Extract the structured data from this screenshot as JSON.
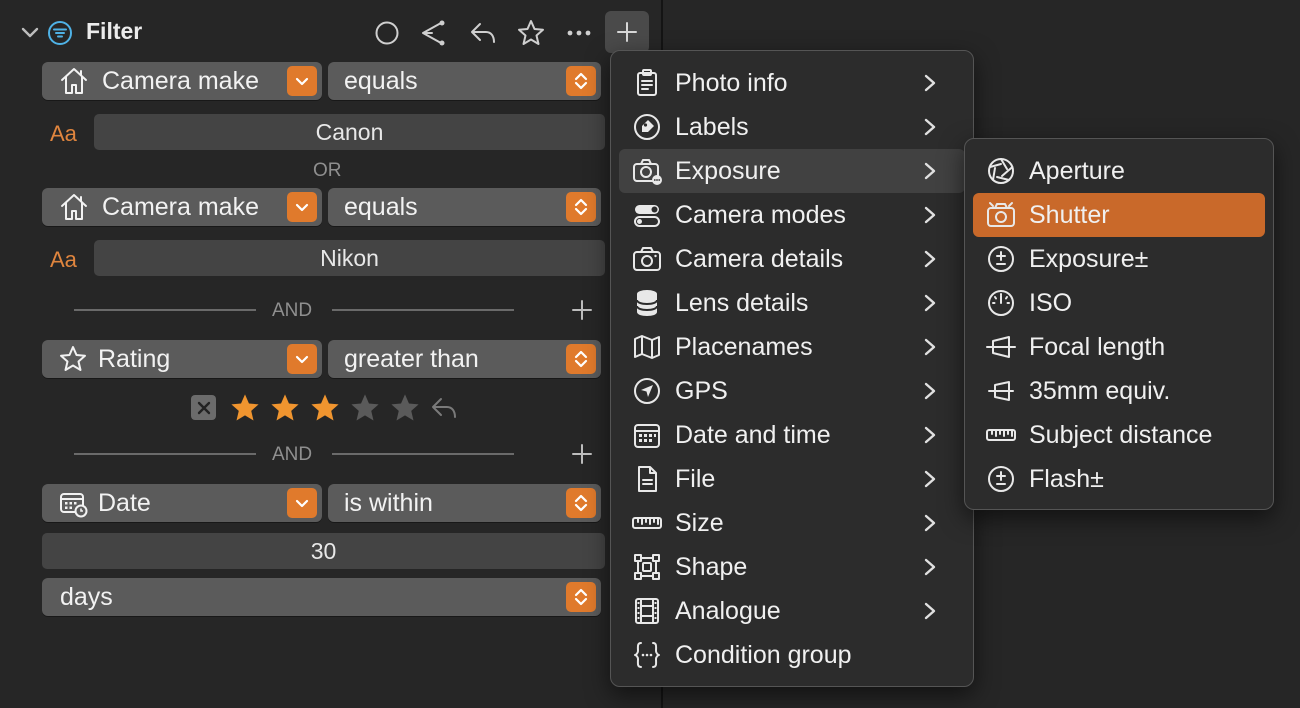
{
  "header": {
    "title": "Filter"
  },
  "conditions": {
    "row1": {
      "field": "Camera make",
      "operator": "equals",
      "value": "Canon",
      "text_type_label": "Aa"
    },
    "or_label": "OR",
    "row2": {
      "field": "Camera make",
      "operator": "equals",
      "value": "Nikon",
      "text_type_label": "Aa"
    },
    "and_label_1": "AND",
    "row3": {
      "field": "Rating",
      "operator": "greater than",
      "rating": 3,
      "rating_max": 5
    },
    "and_label_2": "AND",
    "row4": {
      "field": "Date",
      "operator": "is within",
      "value": "30",
      "unit": "days"
    }
  },
  "add_menu": {
    "items": [
      {
        "label": "Photo info",
        "icon": "clipboard-icon"
      },
      {
        "label": "Labels",
        "icon": "tag-icon"
      },
      {
        "label": "Exposure",
        "icon": "camera-exposure-icon"
      },
      {
        "label": "Camera modes",
        "icon": "toggles-icon"
      },
      {
        "label": "Camera details",
        "icon": "camera-icon"
      },
      {
        "label": "Lens details",
        "icon": "database-icon"
      },
      {
        "label": "Placenames",
        "icon": "map-icon"
      },
      {
        "label": "GPS",
        "icon": "location-arrow-icon"
      },
      {
        "label": "Date and time",
        "icon": "calendar-icon"
      },
      {
        "label": "File",
        "icon": "document-icon"
      },
      {
        "label": "Size",
        "icon": "ruler-icon"
      },
      {
        "label": "Shape",
        "icon": "shape-icon"
      },
      {
        "label": "Analogue",
        "icon": "film-icon"
      },
      {
        "label": "Condition group",
        "icon": "braces-icon"
      }
    ],
    "highlighted": "Exposure"
  },
  "exposure_submenu": {
    "items": [
      {
        "label": "Aperture",
        "icon": "aperture-icon"
      },
      {
        "label": "Shutter",
        "icon": "shutter-camera-icon"
      },
      {
        "label": "Exposure±",
        "icon": "plus-minus-icon"
      },
      {
        "label": "ISO",
        "icon": "iso-gauge-icon"
      },
      {
        "label": "Focal length",
        "icon": "focal-length-icon"
      },
      {
        "label": "35mm equiv.",
        "icon": "focal-equiv-icon"
      },
      {
        "label": "Subject distance",
        "icon": "ruler-icon"
      },
      {
        "label": "Flash±",
        "icon": "plus-minus-icon"
      }
    ],
    "selected": "Shutter"
  },
  "colors": {
    "accent": "#e07a2c",
    "selected_item": "#c9692a",
    "background": "#262626",
    "star_active": "#f0952f",
    "star_inactive": "#5a5a5a"
  }
}
